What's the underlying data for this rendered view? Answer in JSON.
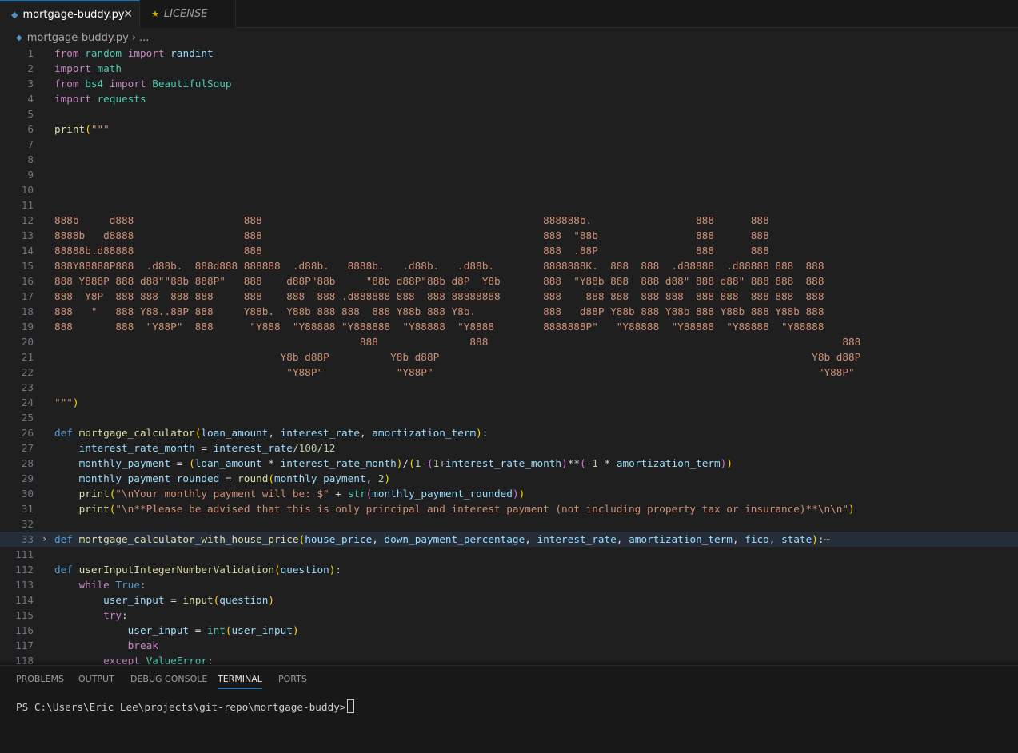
{
  "tabs": [
    {
      "label": "mortgage-buddy.py",
      "icon": "python-file-icon",
      "active": true
    },
    {
      "label": "LICENSE",
      "icon": "license-icon",
      "active": false
    }
  ],
  "breadcrumb": {
    "file": "mortgage-buddy.py",
    "more": "..."
  },
  "colors": {
    "accent": "#0078d4",
    "background": "#1f1f1f",
    "string": "#ce9178"
  },
  "editor": {
    "lines": [
      {
        "n": "1",
        "segs": [
          [
            "k1",
            "from"
          ],
          [
            "op",
            " "
          ],
          [
            "cls",
            "random"
          ],
          [
            "op",
            " "
          ],
          [
            "k1",
            "import"
          ],
          [
            "op",
            " "
          ],
          [
            "p",
            "randint"
          ]
        ]
      },
      {
        "n": "2",
        "segs": [
          [
            "k1",
            "import"
          ],
          [
            "op",
            " "
          ],
          [
            "cls",
            "math"
          ]
        ]
      },
      {
        "n": "3",
        "segs": [
          [
            "k1",
            "from"
          ],
          [
            "op",
            " "
          ],
          [
            "cls",
            "bs4"
          ],
          [
            "op",
            " "
          ],
          [
            "k1",
            "import"
          ],
          [
            "op",
            " "
          ],
          [
            "cls",
            "BeautifulSoup"
          ]
        ]
      },
      {
        "n": "4",
        "segs": [
          [
            "k1",
            "import"
          ],
          [
            "op",
            " "
          ],
          [
            "cls",
            "requests"
          ]
        ]
      },
      {
        "n": "5",
        "segs": []
      },
      {
        "n": "6",
        "segs": [
          [
            "fn",
            "print"
          ],
          [
            "b1",
            "("
          ],
          [
            "s",
            "\"\"\""
          ]
        ]
      },
      {
        "n": "7",
        "segs": []
      },
      {
        "n": "8",
        "segs": []
      },
      {
        "n": "9",
        "segs": []
      },
      {
        "n": "10",
        "segs": []
      },
      {
        "n": "11",
        "segs": []
      },
      {
        "n": "12",
        "segs": [
          [
            "s",
            "888b     d888                  888                                              888888b.                 888      888"
          ]
        ]
      },
      {
        "n": "13",
        "segs": [
          [
            "s",
            "8888b   d8888                  888                                              888  \"88b                888      888"
          ]
        ]
      },
      {
        "n": "14",
        "segs": [
          [
            "s",
            "88888b.d88888                  888                                              888  .88P                888      888"
          ]
        ]
      },
      {
        "n": "15",
        "segs": [
          [
            "s",
            "888Y88888P888  .d88b.  888d888 888888  .d88b.   8888b.   .d88b.   .d88b.        8888888K.  888  888  .d88888  .d88888 888  888"
          ]
        ]
      },
      {
        "n": "16",
        "segs": [
          [
            "s",
            "888 Y888P 888 d88\"\"88b 888P\"   888    d88P\"88b     \"88b d88P\"88b d8P  Y8b       888  \"Y88b 888  888 d88\" 888 d88\" 888 888  888"
          ]
        ]
      },
      {
        "n": "17",
        "segs": [
          [
            "s",
            "888  Y8P  888 888  888 888     888    888  888 .d888888 888  888 88888888       888    888 888  888 888  888 888  888 888  888"
          ]
        ]
      },
      {
        "n": "18",
        "segs": [
          [
            "s",
            "888   \"   888 Y88..88P 888     Y88b.  Y88b 888 888  888 Y88b 888 Y8b.           888   d88P Y88b 888 Y88b 888 Y88b 888 Y88b 888"
          ]
        ]
      },
      {
        "n": "19",
        "segs": [
          [
            "s",
            "888       888  \"Y88P\"  888      \"Y888  \"Y88888 \"Y888888  \"Y88888  \"Y8888        8888888P\"   \"Y88888  \"Y88888  \"Y88888  \"Y88888"
          ]
        ]
      },
      {
        "n": "20",
        "segs": [
          [
            "s",
            "                                                  888               888                                                          888"
          ]
        ]
      },
      {
        "n": "21",
        "segs": [
          [
            "s",
            "                                     Y8b d88P          Y8b d88P                                                             Y8b d88P"
          ]
        ]
      },
      {
        "n": "22",
        "segs": [
          [
            "s",
            "                                      \"Y88P\"            \"Y88P\"                                                               \"Y88P\""
          ]
        ]
      },
      {
        "n": "23",
        "segs": []
      },
      {
        "n": "24",
        "segs": [
          [
            "s",
            "\"\"\""
          ],
          [
            "b1",
            ")"
          ]
        ]
      },
      {
        "n": "25",
        "segs": []
      },
      {
        "n": "26",
        "segs": [
          [
            "k2",
            "def"
          ],
          [
            "op",
            " "
          ],
          [
            "fn",
            "mortgage_calculator"
          ],
          [
            "b1",
            "("
          ],
          [
            "p",
            "loan_amount"
          ],
          [
            "op",
            ", "
          ],
          [
            "p",
            "interest_rate"
          ],
          [
            "op",
            ", "
          ],
          [
            "p",
            "amortization_term"
          ],
          [
            "b1",
            ")"
          ],
          [
            "op",
            ":"
          ]
        ]
      },
      {
        "n": "27",
        "segs": [
          [
            "op",
            "    "
          ],
          [
            "p",
            "interest_rate_month"
          ],
          [
            "op",
            " = "
          ],
          [
            "p",
            "interest_rate"
          ],
          [
            "op",
            "/"
          ],
          [
            "num",
            "100"
          ],
          [
            "op",
            "/"
          ],
          [
            "num",
            "12"
          ]
        ]
      },
      {
        "n": "28",
        "segs": [
          [
            "op",
            "    "
          ],
          [
            "p",
            "monthly_payment"
          ],
          [
            "op",
            " = "
          ],
          [
            "b1",
            "("
          ],
          [
            "p",
            "loan_amount"
          ],
          [
            "op",
            " * "
          ],
          [
            "p",
            "interest_rate_month"
          ],
          [
            "b1",
            ")"
          ],
          [
            "op",
            "/"
          ],
          [
            "b1",
            "("
          ],
          [
            "num",
            "1"
          ],
          [
            "op",
            "-"
          ],
          [
            "b2",
            "("
          ],
          [
            "num",
            "1"
          ],
          [
            "op",
            "+"
          ],
          [
            "p",
            "interest_rate_month"
          ],
          [
            "b2",
            ")"
          ],
          [
            "op",
            "**"
          ],
          [
            "b2",
            "("
          ],
          [
            "op",
            "-"
          ],
          [
            "num",
            "1"
          ],
          [
            "op",
            " * "
          ],
          [
            "p",
            "amortization_term"
          ],
          [
            "b2",
            ")"
          ],
          [
            "b1",
            ")"
          ]
        ]
      },
      {
        "n": "29",
        "segs": [
          [
            "op",
            "    "
          ],
          [
            "p",
            "monthly_payment_rounded"
          ],
          [
            "op",
            " = "
          ],
          [
            "fn",
            "round"
          ],
          [
            "b1",
            "("
          ],
          [
            "p",
            "monthly_payment"
          ],
          [
            "op",
            ", "
          ],
          [
            "num",
            "2"
          ],
          [
            "b1",
            ")"
          ]
        ]
      },
      {
        "n": "30",
        "segs": [
          [
            "op",
            "    "
          ],
          [
            "fn",
            "print"
          ],
          [
            "b1",
            "("
          ],
          [
            "s",
            "\"\\nYour monthly payment will be: $\""
          ],
          [
            "op",
            " + "
          ],
          [
            "cls",
            "str"
          ],
          [
            "b2",
            "("
          ],
          [
            "p",
            "monthly_payment_rounded"
          ],
          [
            "b2",
            ")"
          ],
          [
            "b1",
            ")"
          ]
        ]
      },
      {
        "n": "31",
        "segs": [
          [
            "op",
            "    "
          ],
          [
            "fn",
            "print"
          ],
          [
            "b1",
            "("
          ],
          [
            "s",
            "\"\\n**Please be advised that this is only principal and interest payment (not including property tax or insurance)**\\n\\n\""
          ],
          [
            "b1",
            ")"
          ]
        ]
      },
      {
        "n": "32",
        "segs": []
      },
      {
        "n": "33",
        "fold": true,
        "hl": true,
        "segs": [
          [
            "k2",
            "def"
          ],
          [
            "op",
            " "
          ],
          [
            "fn",
            "mortgage_calculator_with_house_price"
          ],
          [
            "b1",
            "("
          ],
          [
            "p",
            "house_price"
          ],
          [
            "op",
            ", "
          ],
          [
            "p",
            "down_payment_percentage"
          ],
          [
            "op",
            ", "
          ],
          [
            "p",
            "interest_rate"
          ],
          [
            "op",
            ", "
          ],
          [
            "p",
            "amortization_term"
          ],
          [
            "op",
            ", "
          ],
          [
            "p",
            "fico"
          ],
          [
            "op",
            ", "
          ],
          [
            "p",
            "state"
          ],
          [
            "b1",
            ")"
          ],
          [
            "op",
            ":"
          ],
          [
            "ell",
            "⋯"
          ]
        ]
      },
      {
        "n": "111",
        "segs": []
      },
      {
        "n": "112",
        "segs": [
          [
            "k2",
            "def"
          ],
          [
            "op",
            " "
          ],
          [
            "fn",
            "userInputIntegerNumberValidation"
          ],
          [
            "b1",
            "("
          ],
          [
            "p",
            "question"
          ],
          [
            "b1",
            ")"
          ],
          [
            "op",
            ":"
          ]
        ]
      },
      {
        "n": "113",
        "segs": [
          [
            "op",
            "    "
          ],
          [
            "k1",
            "while"
          ],
          [
            "op",
            " "
          ],
          [
            "k2",
            "True"
          ],
          [
            "op",
            ":"
          ]
        ]
      },
      {
        "n": "114",
        "segs": [
          [
            "op",
            "        "
          ],
          [
            "p",
            "user_input"
          ],
          [
            "op",
            " = "
          ],
          [
            "fn",
            "input"
          ],
          [
            "b1",
            "("
          ],
          [
            "p",
            "question"
          ],
          [
            "b1",
            ")"
          ]
        ]
      },
      {
        "n": "115",
        "segs": [
          [
            "op",
            "        "
          ],
          [
            "k1",
            "try"
          ],
          [
            "op",
            ":"
          ]
        ]
      },
      {
        "n": "116",
        "segs": [
          [
            "op",
            "            "
          ],
          [
            "p",
            "user_input"
          ],
          [
            "op",
            " = "
          ],
          [
            "cls",
            "int"
          ],
          [
            "b1",
            "("
          ],
          [
            "p",
            "user_input"
          ],
          [
            "b1",
            ")"
          ]
        ]
      },
      {
        "n": "117",
        "segs": [
          [
            "op",
            "            "
          ],
          [
            "k1",
            "break"
          ]
        ]
      },
      {
        "n": "118",
        "segs": [
          [
            "op",
            "        "
          ],
          [
            "k1",
            "except"
          ],
          [
            "op",
            " "
          ],
          [
            "cls",
            "ValueError"
          ],
          [
            "op",
            ":"
          ]
        ]
      }
    ]
  },
  "panel": {
    "tabs": [
      "PROBLEMS",
      "OUTPUT",
      "DEBUG CONSOLE",
      "TERMINAL",
      "PORTS"
    ],
    "active_tab": "TERMINAL",
    "prompt": "PS C:\\Users\\Eric Lee\\projects\\git-repo\\mortgage-buddy>"
  }
}
